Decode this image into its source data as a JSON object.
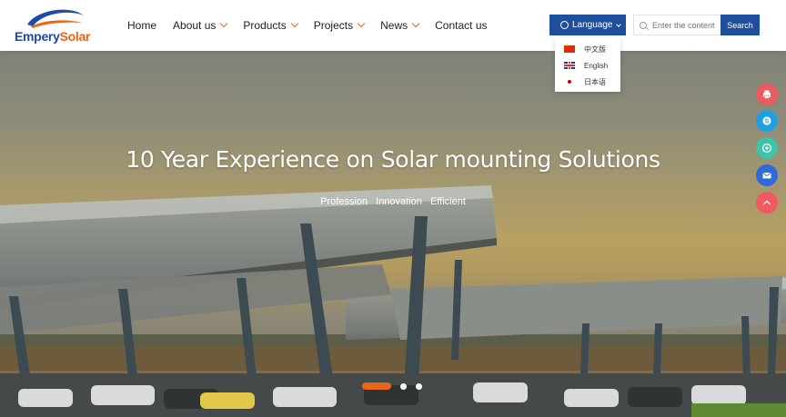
{
  "brand": {
    "name_part1": "Empery",
    "name_part2": "Solar"
  },
  "nav": {
    "items": [
      {
        "label": "Home",
        "dropdown": false
      },
      {
        "label": "About us",
        "dropdown": true
      },
      {
        "label": "Products",
        "dropdown": true
      },
      {
        "label": "Projects",
        "dropdown": true
      },
      {
        "label": "News",
        "dropdown": true
      },
      {
        "label": "Contact us",
        "dropdown": false
      }
    ]
  },
  "language": {
    "button_label": "Language",
    "options": [
      {
        "label": "中文版",
        "flag": "china-flag-icon"
      },
      {
        "label": "English",
        "flag": "uk-flag-icon"
      },
      {
        "label": "日本语",
        "flag": "japan-flag-icon"
      }
    ]
  },
  "search": {
    "placeholder": "Enter the content",
    "button_label": "Search"
  },
  "hero": {
    "title": "10 Year Experience on Solar mounting Solutions",
    "tags": [
      "Profession",
      "Innovation",
      "Efficient"
    ],
    "slides": {
      "total": 3,
      "active": 1
    }
  },
  "side_tools": [
    {
      "icon": "print-icon",
      "color": "#ea5a5f"
    },
    {
      "icon": "skype-icon",
      "color": "#1ba1e2"
    },
    {
      "icon": "whatsapp-icon",
      "color": "#3fc4a8"
    },
    {
      "icon": "email-icon",
      "color": "#2f6bd8"
    },
    {
      "icon": "back-to-top-icon",
      "color": "#ef5b60"
    }
  ],
  "colors": {
    "accent": "#e8651a",
    "primary": "#1d4f9c"
  }
}
